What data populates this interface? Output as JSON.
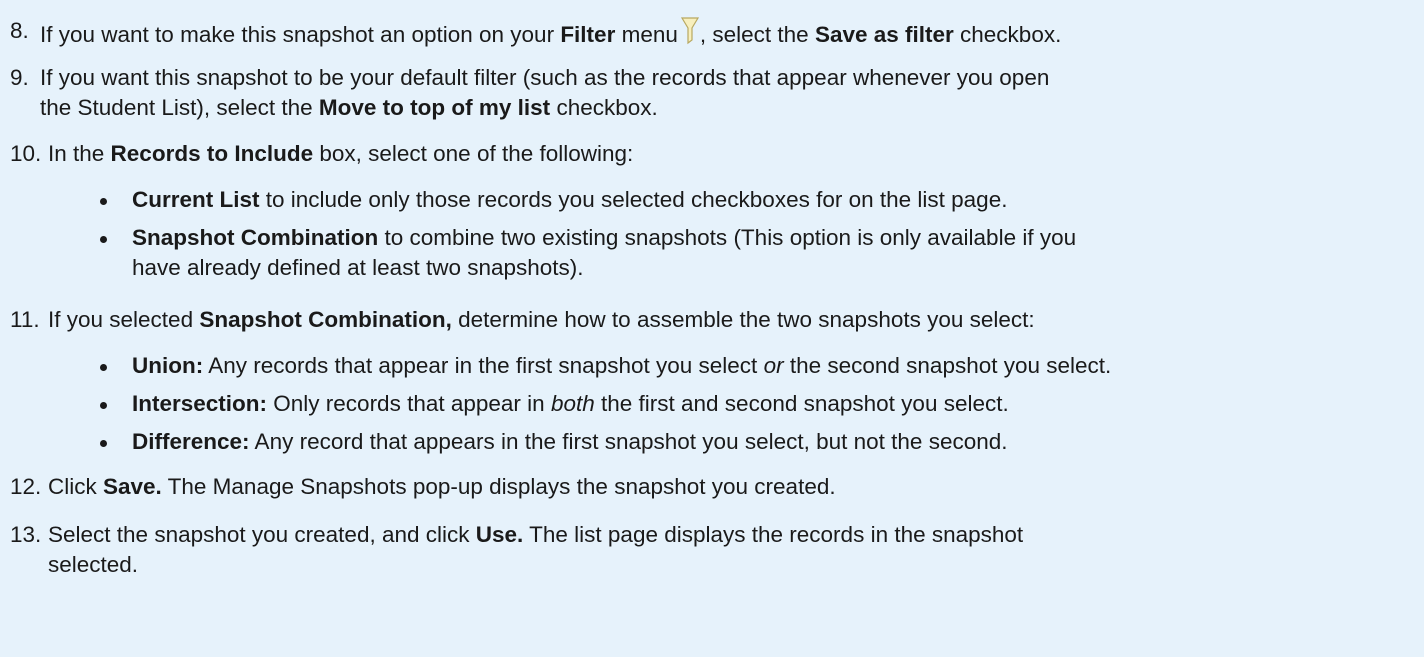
{
  "steps": [
    {
      "num": "8.",
      "parts": [
        {
          "t": "If you want to make this snapshot an option on your ",
          "s": "n"
        },
        {
          "t": "Filter",
          "s": "b"
        },
        {
          "t": " menu",
          "s": "n"
        },
        {
          "t": "filter-icon",
          "s": "icon"
        },
        {
          "t": ", select the ",
          "s": "n"
        },
        {
          "t": "Save as filter",
          "s": "b"
        },
        {
          "t": " checkbox.",
          "s": "n"
        }
      ]
    },
    {
      "num": "9.",
      "line1": [
        {
          "t": "If you want this snapshot to be your default filter (such as the records that appear whenever you open",
          "s": "n"
        }
      ],
      "line2": [
        {
          "t": "the Student List), select the ",
          "s": "n"
        },
        {
          "t": "Move to top of my list",
          "s": "b"
        },
        {
          "t": " checkbox.",
          "s": "n"
        }
      ]
    },
    {
      "num": "10.",
      "parts": [
        {
          "t": "In the ",
          "s": "n"
        },
        {
          "t": "Records to Include",
          "s": "b"
        },
        {
          "t": " box, select one of the following:",
          "s": "n"
        }
      ],
      "bullets": [
        [
          {
            "t": "Current List",
            "s": "b"
          },
          {
            "t": " to include only those records you selected checkboxes for on the list page.",
            "s": "n"
          }
        ],
        [
          {
            "t": "Snapshot Combination",
            "s": "b"
          },
          {
            "t": " to combine two existing snapshots (This option is only available if you",
            "s": "n"
          }
        ],
        [
          {
            "t": "have already defined at least two snapshots).",
            "s": "n"
          }
        ]
      ]
    },
    {
      "num": "11.",
      "parts": [
        {
          "t": "If you selected ",
          "s": "n"
        },
        {
          "t": "Snapshot Combination,",
          "s": "b"
        },
        {
          "t": " determine how to assemble the two snapshots you select:",
          "s": "n"
        }
      ],
      "bullets": [
        [
          {
            "t": "Union:",
            "s": "b"
          },
          {
            "t": " Any records that appear in the first snapshot you select ",
            "s": "n"
          },
          {
            "t": "or",
            "s": "i"
          },
          {
            "t": " the second snapshot you select.",
            "s": "n"
          }
        ],
        [
          {
            "t": "Intersection:",
            "s": "b"
          },
          {
            "t": " Only records that appear in ",
            "s": "n"
          },
          {
            "t": "both",
            "s": "i"
          },
          {
            "t": " the first and second snapshot you select.",
            "s": "n"
          }
        ],
        [
          {
            "t": "Difference:",
            "s": "b"
          },
          {
            "t": " Any record that appears in the first snapshot you select, but not the second.",
            "s": "n"
          }
        ]
      ]
    },
    {
      "num": "12.",
      "parts": [
        {
          "t": "Click ",
          "s": "n"
        },
        {
          "t": "Save.",
          "s": "b"
        },
        {
          "t": " The Manage Snapshots pop-up displays the snapshot you created.",
          "s": "n"
        }
      ]
    },
    {
      "num": "13.",
      "line1": [
        {
          "t": "Select the snapshot you created, and click ",
          "s": "n"
        },
        {
          "t": "Use.",
          "s": "b"
        },
        {
          "t": " The list page displays the records in the snapshot",
          "s": "n"
        }
      ],
      "line2": [
        {
          "t": "selected.",
          "s": "n"
        }
      ]
    }
  ],
  "colors": {
    "background": "#e6f2fb",
    "text": "#1a1a1a",
    "icon_funnel": "#f4e9a8"
  }
}
